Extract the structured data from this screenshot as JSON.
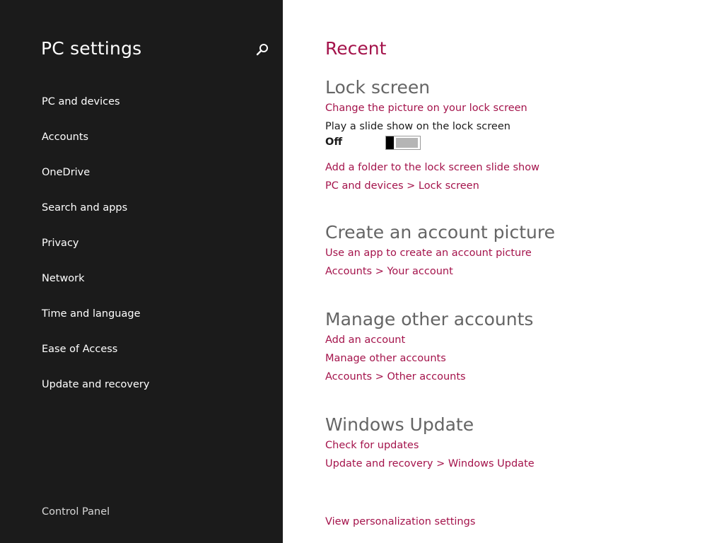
{
  "sidebar": {
    "title": "PC settings",
    "search_icon": "search-icon",
    "items": [
      {
        "label": "PC and devices"
      },
      {
        "label": "Accounts"
      },
      {
        "label": "OneDrive"
      },
      {
        "label": "Search and apps"
      },
      {
        "label": "Privacy"
      },
      {
        "label": "Network"
      },
      {
        "label": "Time and language"
      },
      {
        "label": "Ease of Access"
      },
      {
        "label": "Update and recovery"
      }
    ],
    "control_panel": "Control Panel"
  },
  "main": {
    "heading": "Recent",
    "lock_screen": {
      "title": "Lock screen",
      "change_picture": "Change the picture on your lock screen",
      "slideshow_label": "Play a slide show on the lock screen",
      "slideshow_state": "Off",
      "slideshow_on": false,
      "add_folder": "Add a folder to the lock screen slide show",
      "breadcrumb": "PC and devices > Lock screen"
    },
    "account_picture": {
      "title": "Create an account picture",
      "use_app": "Use an app to create an account picture",
      "breadcrumb": "Accounts > Your account"
    },
    "other_accounts": {
      "title": "Manage other accounts",
      "add": "Add an account",
      "manage": "Manage other accounts",
      "breadcrumb": "Accounts > Other accounts"
    },
    "windows_update": {
      "title": "Windows Update",
      "check": "Check for updates",
      "breadcrumb": "Update and recovery > Windows Update"
    },
    "view_personalization": "View personalization settings"
  },
  "colors": {
    "sidebar_bg": "#1b1b1b",
    "accent": "#a4134b",
    "heading_gray": "#656565",
    "content_bg": "#ffffff"
  }
}
